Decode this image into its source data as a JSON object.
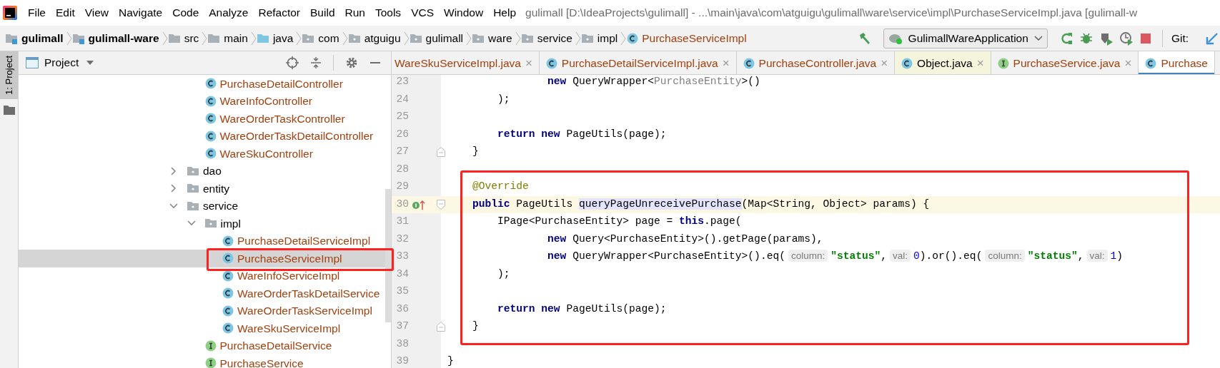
{
  "window": {
    "title": "gulimall [D:\\IdeaProjects\\gulimall] - ...\\main\\java\\com\\atguigu\\gulimall\\ware\\service\\impl\\PurchaseServiceImpl.java [gulimall-w"
  },
  "menu": [
    "File",
    "Edit",
    "View",
    "Navigate",
    "Code",
    "Analyze",
    "Refactor",
    "Build",
    "Run",
    "Tools",
    "VCS",
    "Window",
    "Help"
  ],
  "breadcrumbs": [
    {
      "label": "gulimall",
      "kind": "module"
    },
    {
      "label": "gulimall-ware",
      "kind": "module"
    },
    {
      "label": "src",
      "kind": "folder"
    },
    {
      "label": "main",
      "kind": "folder"
    },
    {
      "label": "java",
      "kind": "source"
    },
    {
      "label": "com",
      "kind": "package"
    },
    {
      "label": "atguigu",
      "kind": "package"
    },
    {
      "label": "gulimall",
      "kind": "package"
    },
    {
      "label": "ware",
      "kind": "package"
    },
    {
      "label": "service",
      "kind": "package"
    },
    {
      "label": "impl",
      "kind": "package"
    },
    {
      "label": "PurchaseServiceImpl",
      "kind": "class"
    }
  ],
  "toolbar": {
    "run_config": "GulimallWareApplication",
    "vcs_label": "Git:"
  },
  "tool_strip": {
    "label": "1: Project",
    "selected": true
  },
  "project_panel": {
    "title": "Project"
  },
  "tree": [
    {
      "children": [
        {
          "label": "PurchaseDetailController",
          "kind": "class",
          "selected": false
        },
        {
          "label": "WareInfoController",
          "kind": "class",
          "selected": false
        },
        {
          "label": "WareOrderTaskController",
          "kind": "class",
          "selected": false
        },
        {
          "label": "WareOrderTaskDetailController",
          "kind": "class",
          "selected": false
        },
        {
          "label": "WareSkuController",
          "kind": "class",
          "selected": false
        }
      ]
    },
    {
      "label": "dao",
      "kind": "package",
      "expanded": false,
      "selected": false
    },
    {
      "label": "entity",
      "kind": "package",
      "expanded": false,
      "selected": false
    },
    {
      "label": "service",
      "kind": "package",
      "expanded": true,
      "selected": false,
      "children": [
        {
          "label": "impl",
          "kind": "package",
          "expanded": true,
          "selected": false,
          "children": [
            {
              "label": "PurchaseDetailServiceImpl",
              "kind": "class",
              "selected": false
            },
            {
              "label": "PurchaseServiceImpl",
              "kind": "class",
              "selected": true,
              "outlined": true
            },
            {
              "label": "WareInfoServiceImpl",
              "kind": "class",
              "selected": false
            },
            {
              "label": "WareOrderTaskDetailService",
              "kind": "class",
              "selected": false
            },
            {
              "label": "WareOrderTaskServiceImpl",
              "kind": "class",
              "selected": false
            },
            {
              "label": "WareSkuServiceImpl",
              "kind": "class",
              "selected": false
            }
          ]
        },
        {
          "label": "PurchaseDetailService",
          "kind": "interface",
          "selected": false
        },
        {
          "label": "PurchaseService",
          "kind": "interface",
          "selected": false
        }
      ]
    }
  ],
  "tabs": [
    {
      "label": "WareSkuServiceImpl.java",
      "external": false,
      "selected": false,
      "close": "×"
    },
    {
      "label": "PurchaseDetailServiceImpl.java",
      "kind": "class",
      "external": false,
      "selected": false,
      "close": "×"
    },
    {
      "label": "PurchaseController.java",
      "kind": "class",
      "external": false,
      "selected": false,
      "close": "×"
    },
    {
      "label": "Object.java",
      "kind": "class",
      "external": true,
      "selected": false,
      "close": "×"
    },
    {
      "label": "PurchaseService.java",
      "kind": "interface",
      "external": false,
      "selected": false,
      "close": "×"
    },
    {
      "label": "Purchase",
      "kind": "class",
      "external": false,
      "selected": true
    }
  ],
  "code_blocks": [
    {
      "outlined": false,
      "lines": [
        {
          "number": "23",
          "kind": "continuation",
          "current": false,
          "tokens": [
            {
              "kind": "kw",
              "text": "new"
            },
            {
              "kind": "plain",
              "text": " QueryWrapper<"
            },
            {
              "kind": "muted",
              "text": "PurchaseEntity"
            },
            {
              "kind": "plain",
              "text": ">()"
            }
          ]
        },
        {
          "number": "24",
          "kind": "body",
          "current": false,
          "tokens": [
            {
              "kind": "plain",
              "text": ");"
            }
          ]
        },
        {
          "number": "25",
          "current": false
        },
        {
          "number": "26",
          "kind": "body",
          "current": false,
          "tokens": [
            {
              "kind": "kw",
              "text": "return new"
            },
            {
              "kind": "plain",
              "text": " PageUtils(page);"
            }
          ]
        },
        {
          "number": "27",
          "kind": "member",
          "current": false,
          "fold_marker": {
            "kind": "end"
          },
          "tokens": [
            {
              "kind": "plain",
              "text": "}"
            }
          ]
        },
        {
          "number": "28",
          "current": false
        }
      ]
    },
    {
      "outlined": true,
      "lines": [
        {
          "number": "29",
          "kind": "member",
          "current": false,
          "tokens": [
            {
              "kind": "annotation",
              "text": "@Override"
            }
          ]
        },
        {
          "number": "30",
          "kind": "member",
          "current": true,
          "gutter_icon": {
            "kind": "implements"
          },
          "fold_marker": {
            "kind": "start"
          },
          "tokens": [
            {
              "kind": "kw",
              "text": "public"
            },
            {
              "kind": "plain",
              "text": " PageUtils "
            },
            {
              "kind": "declaration",
              "text": "queryPageUnreceivePurchase"
            },
            {
              "kind": "plain",
              "text": "(Map<String, Object> params) {"
            }
          ]
        },
        {
          "number": "31",
          "kind": "body",
          "current": false,
          "tokens": [
            {
              "kind": "plain",
              "text": "IPage<PurchaseEntity> page = "
            },
            {
              "kind": "kw",
              "text": "this"
            },
            {
              "kind": "plain",
              "text": ".page("
            }
          ]
        },
        {
          "number": "32",
          "kind": "continuation",
          "current": false,
          "tokens": [
            {
              "kind": "kw",
              "text": "new"
            },
            {
              "kind": "plain",
              "text": " Query<PurchaseEntity>().getPage(params),"
            }
          ]
        },
        {
          "number": "33",
          "kind": "continuation",
          "current": false,
          "tokens": [
            {
              "kind": "kw",
              "text": "new"
            },
            {
              "kind": "plain",
              "text": " QueryWrapper<PurchaseEntity>().eq("
            },
            {
              "kind": "hint",
              "text": "column:"
            },
            {
              "kind": "string",
              "text": "\"status\""
            },
            {
              "kind": "plain",
              "text": ","
            },
            {
              "kind": "hint",
              "text": "val:"
            },
            {
              "kind": "number",
              "text": "0"
            },
            {
              "kind": "plain",
              "text": ").or().eq("
            },
            {
              "kind": "hint",
              "text": "column:"
            },
            {
              "kind": "string",
              "text": "\"status\""
            },
            {
              "kind": "plain",
              "text": ","
            },
            {
              "kind": "hint",
              "text": "val:"
            },
            {
              "kind": "number",
              "text": "1"
            },
            {
              "kind": "plain",
              "text": ")"
            }
          ]
        },
        {
          "number": "34",
          "kind": "body",
          "current": false,
          "tokens": [
            {
              "kind": "plain",
              "text": ");"
            }
          ]
        },
        {
          "number": "35",
          "current": false
        },
        {
          "number": "36",
          "kind": "body",
          "current": false,
          "tokens": [
            {
              "kind": "kw",
              "text": "return new"
            },
            {
              "kind": "plain",
              "text": " PageUtils(page);"
            }
          ]
        },
        {
          "number": "37",
          "kind": "member",
          "current": false,
          "fold_marker": {
            "kind": "end"
          },
          "tokens": [
            {
              "kind": "plain",
              "text": "}"
            }
          ]
        }
      ]
    },
    {
      "outlined": false,
      "lines": [
        {
          "number": "38",
          "current": false
        },
        {
          "number": "39",
          "current": false,
          "tokens": [
            {
              "kind": "plain",
              "text": "}"
            }
          ]
        }
      ]
    }
  ]
}
